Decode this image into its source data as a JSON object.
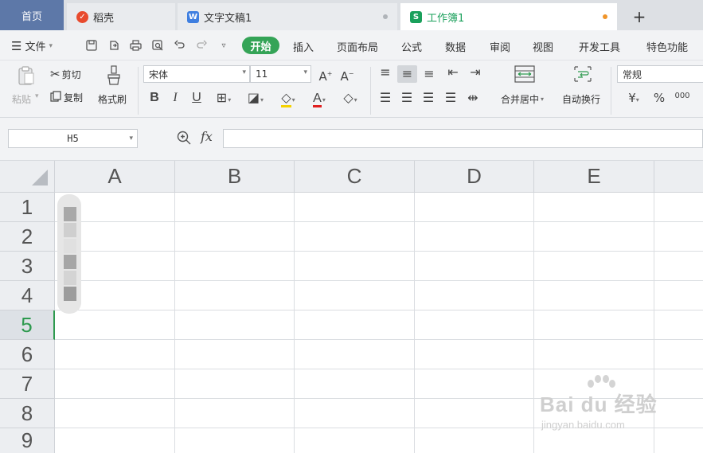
{
  "tabs": {
    "home": "首页",
    "daoke": "稻壳",
    "doc": "文字文稿1",
    "book": "工作簿1",
    "add": "+"
  },
  "menu": {
    "file": "文件",
    "items": [
      "开始",
      "插入",
      "页面布局",
      "公式",
      "数据",
      "审阅",
      "视图",
      "开发工具",
      "特色功能"
    ]
  },
  "ribbon": {
    "paste": "粘贴",
    "cut": "剪切",
    "copy": "复制",
    "format_painter": "格式刷",
    "font_name": "宋体",
    "font_size": "11",
    "merge_center": "合并居中",
    "wrap_text": "自动换行",
    "number_format": "常规",
    "currency": "¥",
    "percent": "%",
    "thousands": "000"
  },
  "formula_bar": {
    "name_box": "H5",
    "fx": "fx",
    "formula": ""
  },
  "sheet": {
    "columns": [
      "A",
      "B",
      "C",
      "D",
      "E"
    ],
    "rows": [
      "1",
      "2",
      "3",
      "4",
      "5",
      "6",
      "7",
      "8",
      "9"
    ],
    "active_row": "5"
  },
  "watermark": {
    "main": "Bai du 经验",
    "sub": "jingyan.baidu.com"
  },
  "colors": {
    "accent_green": "#35a457",
    "home_tab": "#5d78a8",
    "active_row_text": "#2e9a4f"
  },
  "icons": [
    "daoke-icon",
    "doc-icon",
    "spreadsheet-icon",
    "menu-icon",
    "save-icon",
    "print-icon",
    "undo-icon",
    "redo-icon",
    "zoom-icon"
  ]
}
